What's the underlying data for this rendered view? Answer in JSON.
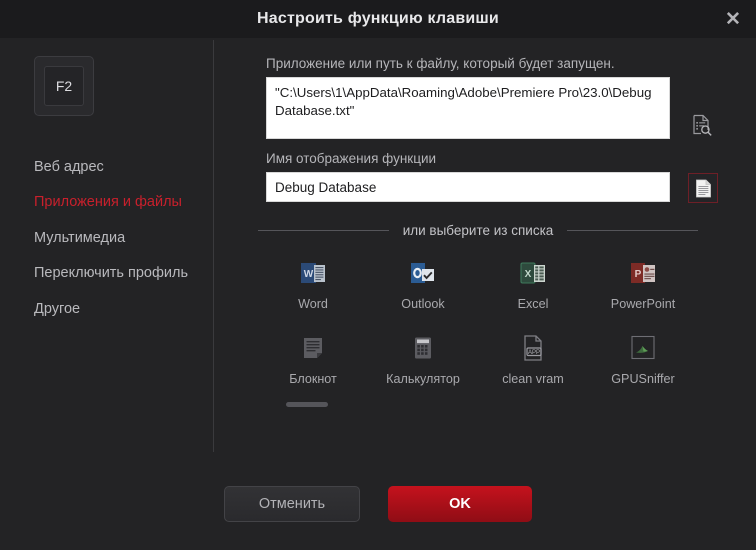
{
  "window": {
    "title": "Настроить функцию клавиши",
    "close_icon": "close-icon",
    "close_glyph": "✕"
  },
  "sidebar": {
    "key": {
      "label": "F2"
    },
    "items": [
      {
        "label": "Веб адрес",
        "active": false
      },
      {
        "label": "Приложения и файлы",
        "active": true
      },
      {
        "label": "Мультимедиа",
        "active": false
      },
      {
        "label": "Переключить профиль",
        "active": false
      },
      {
        "label": "Другое",
        "active": false
      }
    ]
  },
  "main": {
    "path_field": {
      "label": "Приложение или путь к файлу, который будет запущен.",
      "value": "\"C:\\Users\\1\\AppData\\Roaming\\Adobe\\Premiere Pro\\23.0\\Debug Database.txt\"",
      "placeholder": "",
      "browse_icon": "file-search-icon"
    },
    "name_field": {
      "label": "Имя отображения функции",
      "value": "Debug Database",
      "placeholder": "",
      "doc_icon": "document-icon"
    },
    "or_label": "или выберите из списка",
    "apps": [
      {
        "label": "Word",
        "icon": "word-icon"
      },
      {
        "label": "Outlook",
        "icon": "outlook-icon"
      },
      {
        "label": "Excel",
        "icon": "excel-icon"
      },
      {
        "label": "PowerPoint",
        "icon": "powerpoint-icon"
      },
      {
        "label": "Блокнот",
        "icon": "notepad-icon"
      },
      {
        "label": "Калькулятор",
        "icon": "calculator-icon"
      },
      {
        "label": "clean vram",
        "icon": "app-file-icon"
      },
      {
        "label": "GPUSniffer",
        "icon": "gpusniffer-icon"
      }
    ]
  },
  "footer": {
    "cancel_label": "Отменить",
    "ok_label": "OK"
  },
  "colors": {
    "accent_red": "#c8202c",
    "ok_button": "#c5121d",
    "dialog_bg": "#232325",
    "titlebar_bg": "#1b1b1d"
  }
}
